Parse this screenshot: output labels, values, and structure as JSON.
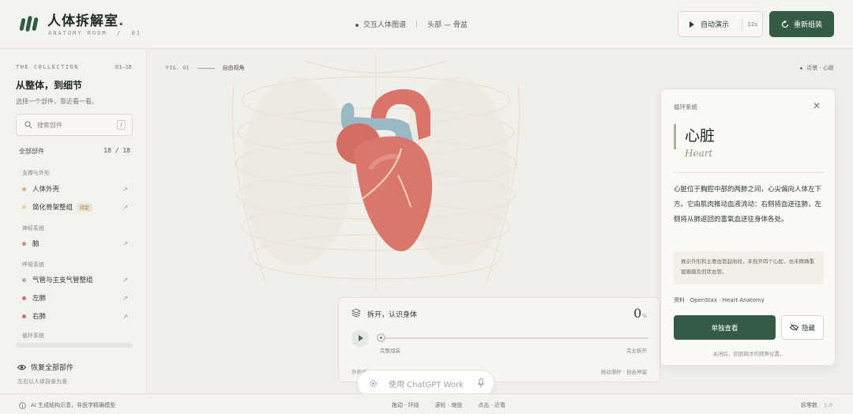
{
  "header": {
    "logo_title": "人体拆解室",
    "logo_dot": ".",
    "logo_sub": "ANATOMY ROOM",
    "logo_num": "01",
    "center_tag": "交互人体图谱",
    "center_path_a": "头部",
    "center_path_sep": "—",
    "center_path_b": "骨盆",
    "auto_demo_label": "自动演示",
    "auto_demo_badge": "12s",
    "reset_label": "重新组装"
  },
  "sidebar": {
    "collection_label": "THE COLLECTION",
    "collection_range": "01—18",
    "title": "从整体，到细节",
    "subtitle": "选择一个部件，靠近看一看。",
    "search_placeholder": "搜索部件",
    "search_shortcut": "/",
    "all_parts_label": "全部部件",
    "all_parts_count": "18 / 18",
    "groups": [
      {
        "label": "支撑与外形"
      },
      {
        "label": "神经系统"
      },
      {
        "label": "呼吸系统"
      },
      {
        "label": "循环系统"
      }
    ],
    "items": [
      {
        "label": "人体外壳",
        "color": "#d9b08c"
      },
      {
        "label": "简化骨架整组",
        "tag": "待定",
        "color": "#e4d1a0"
      },
      {
        "label": "脑",
        "color": "#d48a8a"
      },
      {
        "label": "气管与主支气管整组",
        "color": "#9fb7aa"
      },
      {
        "label": "左肺",
        "color": "#c96f6f"
      },
      {
        "label": "右肺",
        "color": "#c96f6f"
      }
    ],
    "restore_label": "恢复全部部件",
    "note": "左右以人体自身为准"
  },
  "canvas": {
    "fig_label": "FIG. 01",
    "view_label": "自由视角",
    "near_label": "近景 · 心脏"
  },
  "control": {
    "title": "拆开，认识身体",
    "percent": "0",
    "percent_unit": "%",
    "progress": 0,
    "left_label": "完整组装",
    "right_label": "完全拆开",
    "bottom_left": "外壳透明",
    "bottom_right": "拖动滑杆 · 自由停留"
  },
  "chat": {
    "placeholder": "使用 ChatGPT Work"
  },
  "card": {
    "category": "循环系统",
    "title": "心脏",
    "title_en": "Heart",
    "description": "心脏位于胸腔中部的两肺之间，心尖偏向人体左下方。它由肌肉推动血液流动：右侧将血送往肺，左侧将从肺返回的富氧血送往身体各处。",
    "note": "展示外形和主要血管起始段，未剖开四个心腔，也未精确重建瓣膜及冠状血管。",
    "source": "资料 · OpenStax · Heart Anatomy",
    "primary_button": "单独查看",
    "hide_button": "隐藏",
    "footer": "关闭后，回到刚才的观察位置。"
  },
  "footer": {
    "left": "AI 生成结构示意，非医学精确模型",
    "center": [
      "拖动 · 环绕",
      "滚轮 · 缩放",
      "点击 · 近看"
    ],
    "right_label": "拆零数",
    "right_value": "1.0"
  },
  "colors": {
    "accent": "#355a45",
    "heart": "#d9746a",
    "vessel": "#9bb9c4"
  }
}
